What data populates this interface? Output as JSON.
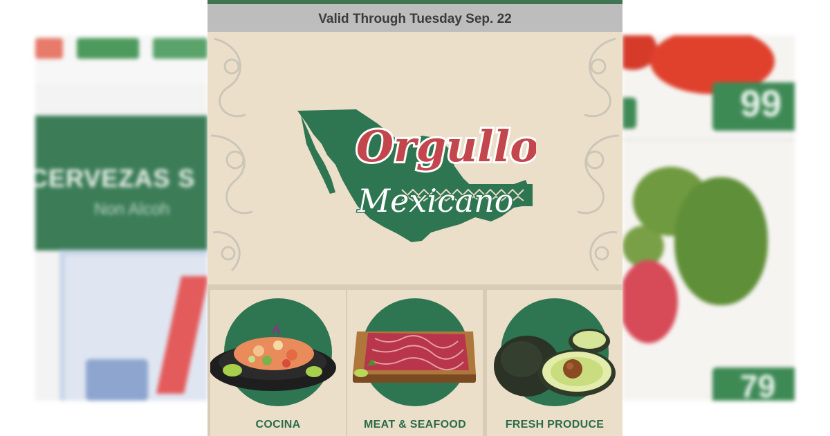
{
  "banner": {
    "valid_through": "Valid Through Tuesday Sep. 22"
  },
  "hero": {
    "title_line1": "Orgullo",
    "title_line2": "Mexicano"
  },
  "categories": [
    {
      "label": "COCINA",
      "icon": "ceviche-plate-image"
    },
    {
      "label": "MEAT & SEAFOOD",
      "icon": "beef-cutting-board-image"
    },
    {
      "label": "FRESH PRODUCE",
      "icon": "avocado-image"
    }
  ],
  "background_left": {
    "heading": "CERVEZAS S",
    "subheading": "Non Alcoh"
  },
  "background_right": {
    "price_top": "99",
    "price_bottom": "79"
  },
  "colors": {
    "brand_green": "#2e7551",
    "title_red": "#c2464c",
    "paper": "#ebdfca",
    "banner_gray": "#bdbdbd"
  }
}
